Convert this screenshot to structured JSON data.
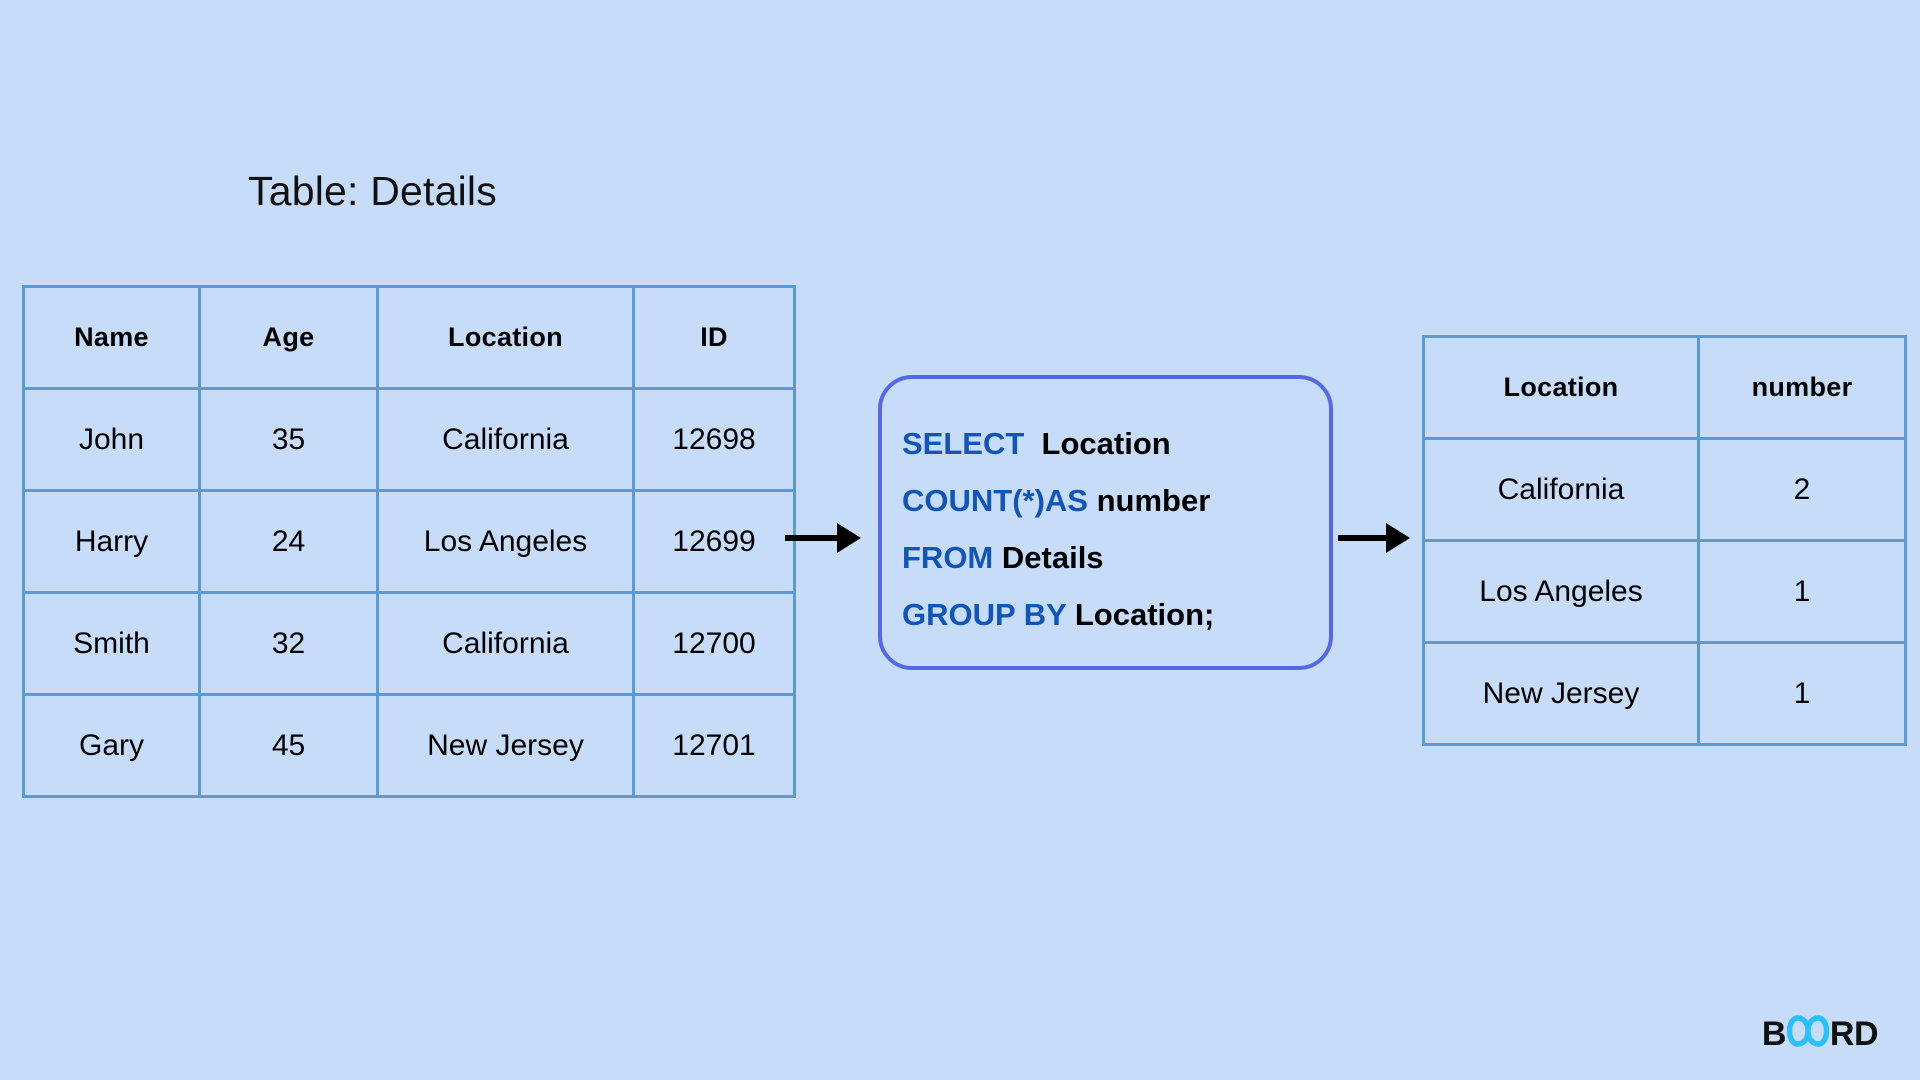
{
  "canvas": {
    "background_color": "#c7dcf8",
    "table_border_color": "#5b9bd5",
    "query_border_color": "#5568e8",
    "keyword_color": "#1155bb",
    "logo_accent_color": "#29c0ff"
  },
  "source_table": {
    "title": "Table: Details",
    "columns": [
      "Name",
      "Age",
      "Location",
      "ID"
    ],
    "rows": [
      [
        "John",
        "35",
        "California",
        "12698"
      ],
      [
        "Harry",
        "24",
        "Los Angeles",
        "12699"
      ],
      [
        "Smith",
        "32",
        "California",
        "12700"
      ],
      [
        "Gary",
        "45",
        "New Jersey",
        "12701"
      ]
    ]
  },
  "query": {
    "lines": [
      {
        "keyword": "SELECT",
        "rest": "Location"
      },
      {
        "keyword": "COUNT(*)AS",
        "rest": "number"
      },
      {
        "keyword": "FROM",
        "rest": "Details"
      },
      {
        "keyword": "GROUP BY",
        "rest": "Location;"
      }
    ],
    "full_text": "SELECT Location COUNT(*)AS number FROM Details GROUP BY Location;"
  },
  "result_table": {
    "columns": [
      "Location",
      "number"
    ],
    "rows": [
      [
        "California",
        "2"
      ],
      [
        "Los Angeles",
        "1"
      ],
      [
        "New Jersey",
        "1"
      ]
    ]
  },
  "arrows": [
    {
      "label": "source-to-query"
    },
    {
      "label": "query-to-result"
    }
  ],
  "logo": {
    "prefix": "B",
    "mark": "OA",
    "suffix": "RD",
    "full_text": "BOARD"
  }
}
